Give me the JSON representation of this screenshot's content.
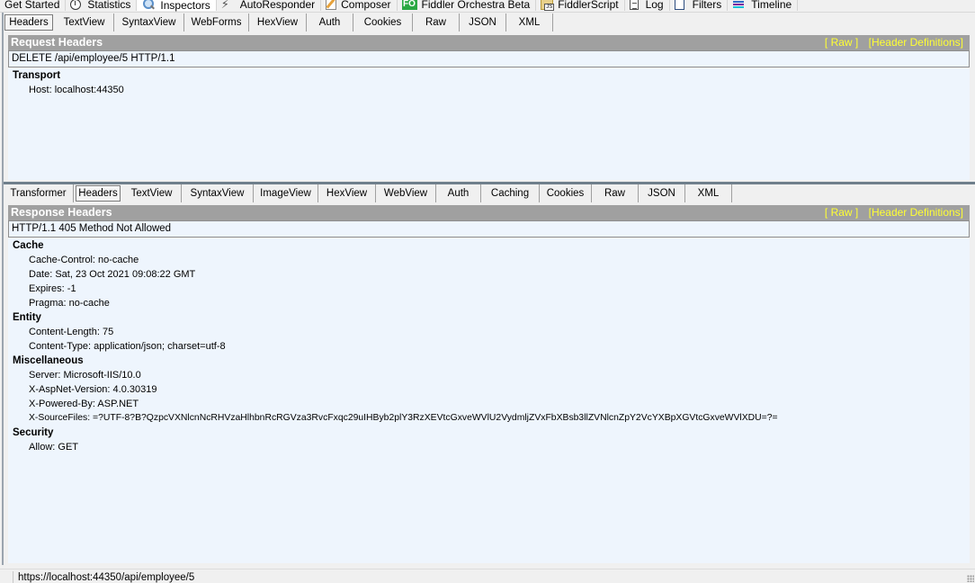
{
  "top_tabs": [
    {
      "label": "Get Started",
      "icon": "none"
    },
    {
      "label": "Statistics",
      "icon": "stopwatch-icon"
    },
    {
      "label": "Inspectors",
      "icon": "magnifier-icon",
      "active": true
    },
    {
      "label": "AutoResponder",
      "icon": "lightning-icon"
    },
    {
      "label": "Composer",
      "icon": "pencil-icon"
    },
    {
      "label": "Fiddler Orchestra Beta",
      "icon": "fo-icon",
      "icon_text": "FO"
    },
    {
      "label": "FiddlerScript",
      "icon": "js-script-icon"
    },
    {
      "label": "Log",
      "icon": "log-icon"
    },
    {
      "label": "Filters",
      "icon": "filter-icon"
    },
    {
      "label": "Timeline",
      "icon": "timeline-icon"
    }
  ],
  "request": {
    "tabs": [
      "Headers",
      "TextView",
      "SyntaxView",
      "WebForms",
      "HexView",
      "Auth",
      "Cookies",
      "Raw",
      "JSON",
      "XML"
    ],
    "active_tab": "Headers",
    "title": "Request Headers",
    "links": {
      "raw": "[ Raw ]",
      "defs": "[Header Definitions]"
    },
    "request_line": "DELETE /api/employee/5 HTTP/1.1",
    "groups": [
      {
        "name": "Transport",
        "items": [
          "Host: localhost:44350"
        ]
      }
    ]
  },
  "response": {
    "tabs": [
      "Transformer",
      "Headers",
      "TextView",
      "SyntaxView",
      "ImageView",
      "HexView",
      "WebView",
      "Auth",
      "Caching",
      "Cookies",
      "Raw",
      "JSON",
      "XML"
    ],
    "active_tab": "Headers",
    "title": "Response Headers",
    "links": {
      "raw": "[ Raw ]",
      "defs": "[Header Definitions]"
    },
    "status_line": "HTTP/1.1 405 Method Not Allowed",
    "groups": [
      {
        "name": "Cache",
        "items": [
          "Cache-Control: no-cache",
          "Date: Sat, 23 Oct 2021 09:08:22 GMT",
          "Expires: -1",
          "Pragma: no-cache"
        ]
      },
      {
        "name": "Entity",
        "items": [
          "Content-Length: 75",
          "Content-Type: application/json; charset=utf-8"
        ]
      },
      {
        "name": "Miscellaneous",
        "items": [
          "Server: Microsoft-IIS/10.0",
          "X-AspNet-Version: 4.0.30319",
          "X-Powered-By: ASP.NET",
          "X-SourceFiles: =?UTF-8?B?QzpcVXNlcnNcRHVzaHlhbnRcRGVza3RvcFxqc29uIHByb2plY3RzXEVtcGxveWVlU2VydmljZVxFbXBsb3llZVNlcnZpY2VcYXBpXGVtcGxveWVlXDU=?="
        ]
      },
      {
        "name": "Security",
        "items": [
          "Allow: GET"
        ]
      }
    ]
  },
  "status_bar": {
    "url": "https://localhost:44350/api/employee/5"
  },
  "colors": {
    "header_bar": "#a0a0a0",
    "link_yellow": "#ffff33",
    "pane_bg": "#eef5fd",
    "splitter": "#6f7f8c"
  }
}
